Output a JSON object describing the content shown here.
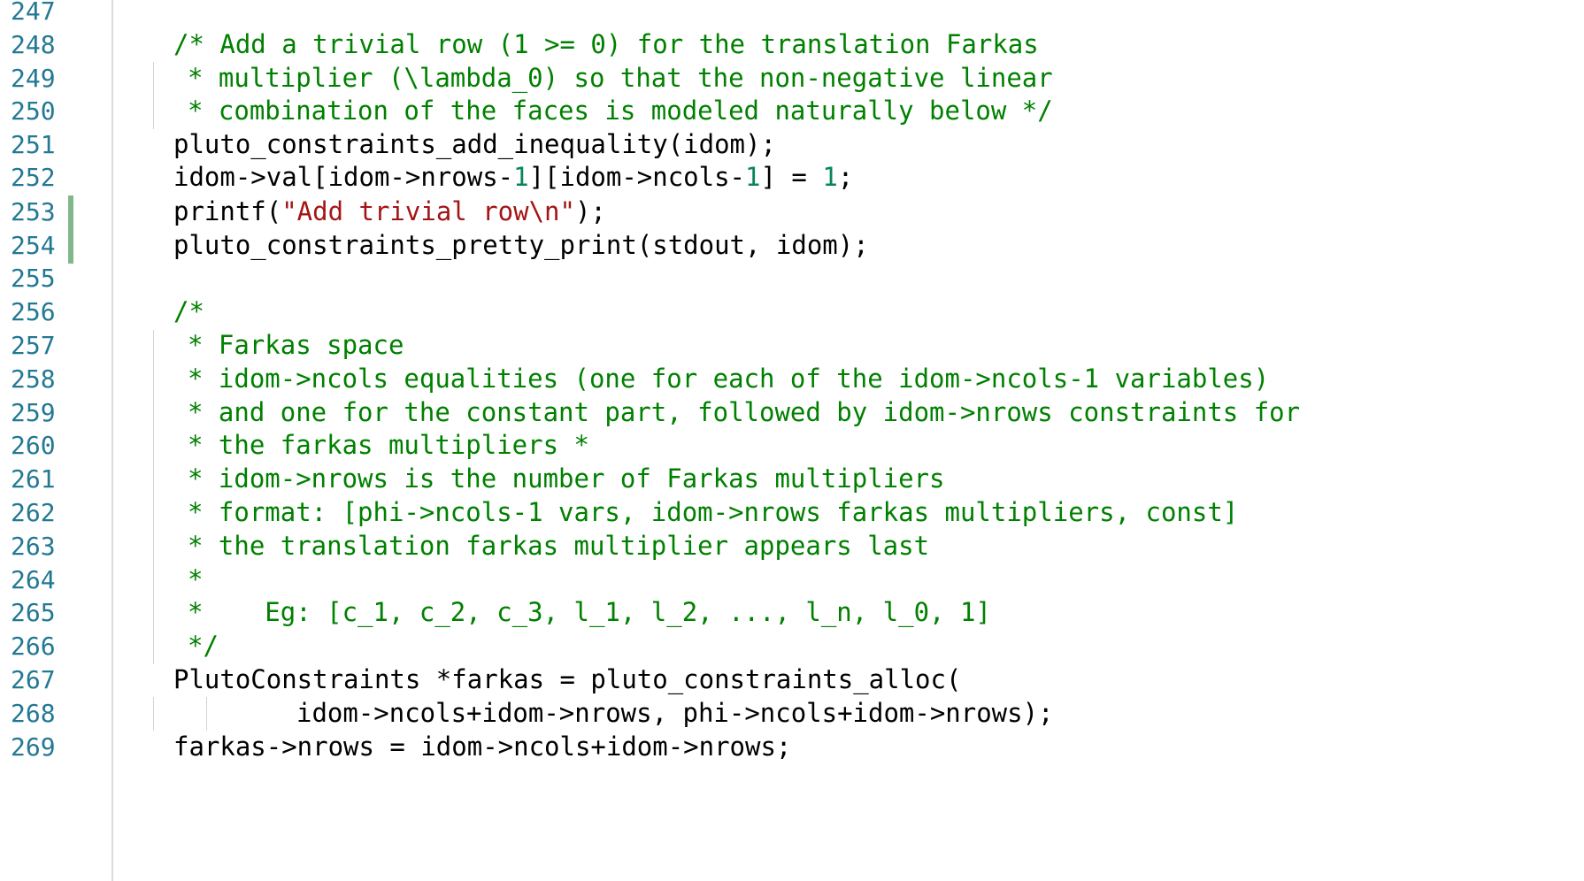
{
  "line_numbers": [
    "247",
    "248",
    "249",
    "250",
    "251",
    "252",
    "253",
    "254",
    "255",
    "256",
    "257",
    "258",
    "259",
    "260",
    "261",
    "262",
    "263",
    "264",
    "265",
    "266",
    "267",
    "268",
    "269"
  ],
  "code": {
    "l248": "/* Add a trivial row (1 >= 0) for the translation Farkas",
    "l249": "* multiplier (\\lambda_0) so that the non-negative linear",
    "l250": "* combination of the faces is modeled naturally below */",
    "l251": "pluto_constraints_add_inequality(idom);",
    "l252a": "idom->val[idom->nrows-",
    "l252b": "1",
    "l252c": "][idom->ncols-",
    "l252d": "1",
    "l252e": "] = ",
    "l252f": "1",
    "l252g": ";",
    "l253a": "printf(",
    "l253b": "\"Add trivial row\\n\"",
    "l253c": ");",
    "l254": "pluto_constraints_pretty_print(stdout, idom);",
    "l256": "/*",
    "l257": "* Farkas space",
    "l258": "* idom->ncols equalities (one for each of the idom->ncols-1 variables)",
    "l259": "* and one for the constant part, followed by idom->nrows constraints for",
    "l260": "* the farkas multipliers *",
    "l261": "* idom->nrows is the number of Farkas multipliers",
    "l262": "* format: [phi->ncols-1 vars, idom->nrows farkas multipliers, const]",
    "l263": "* the translation farkas multiplier appears last",
    "l264": "*",
    "l265": "*    Eg: [c_1, c_2, c_3, l_1, l_2, ..., l_n, l_0, 1]",
    "l266": "*/",
    "l267": "PlutoConstraints *farkas = pluto_constraints_alloc(",
    "l268": "idom->ncols+idom->nrows, phi->ncols+idom->nrows);",
    "l269": "farkas->nrows = idom->ncols+idom->nrows;"
  },
  "colors": {
    "comment": "#008000",
    "string": "#a31515",
    "number": "#098658",
    "line_number": "#237893",
    "modified_bar": "#81b88b"
  }
}
